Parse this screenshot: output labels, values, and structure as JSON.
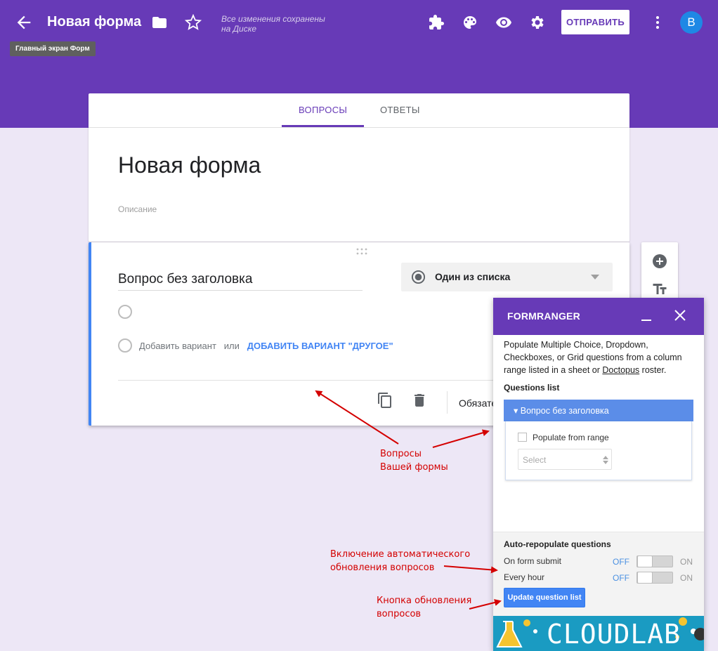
{
  "header": {
    "title": "Новая форма",
    "save_status": "Все изменения сохранены на Диске",
    "tooltip": "Главный экран Форм",
    "send_label": "ОТПРАВИТЬ",
    "avatar_initial": "В"
  },
  "tabs": [
    {
      "label": "ВОПРОСЫ",
      "active": true
    },
    {
      "label": "ОТВЕТЫ",
      "active": false
    }
  ],
  "form": {
    "heading": "Новая форма",
    "description_placeholder": "Описание"
  },
  "question": {
    "title": "Вопрос без заголовка",
    "type": "Один из списка",
    "add_option": "Добавить вариант",
    "or": "или",
    "add_other": "ДОБАВИТЬ ВАРИАНТ \"ДРУГОЕ\"",
    "required_label": "Обязате"
  },
  "formranger": {
    "title": "FORMRANGER",
    "desc_before_link": "Populate Multiple Choice, Dropdown, Checkboxes, or Grid questions from a column range listed in a sheet or",
    "link": "Doctopus",
    "desc_after_link": "roster.",
    "questions_list_label": "Questions list",
    "question_item": "Вопрос без заголовка",
    "populate_label": "Populate from range",
    "select_placeholder": "Select",
    "auto_title": "Auto-repopulate questions",
    "rows": [
      {
        "label": "On form submit",
        "off": "OFF",
        "on": "ON"
      },
      {
        "label": "Every hour",
        "off": "OFF",
        "on": "ON"
      }
    ],
    "update_button": "Update question list",
    "banner_text": "CLOUDLAB"
  },
  "annotations": {
    "questions_note": [
      "Вопросы",
      "Вашей формы"
    ],
    "auto_note": [
      "Включение автоматического",
      "обновления вопросов"
    ],
    "button_note": [
      "Кнопка обновления",
      "вопросов"
    ]
  },
  "colors": {
    "primary": "#673ab7",
    "accent_blue": "#4285f4",
    "annotation_red": "#d40000",
    "background": "#ede7f6"
  }
}
